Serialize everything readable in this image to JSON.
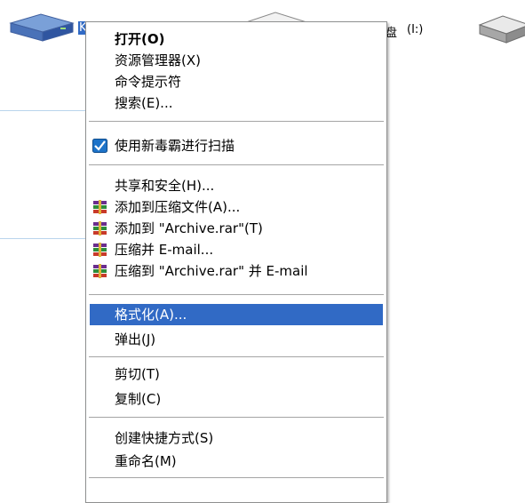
{
  "desktop": {
    "drive_left_label": "K",
    "drive_center_label": "(I:)",
    "drive_center_label_prefix": "盘"
  },
  "menu": {
    "items": [
      {
        "label": "打开(O)",
        "bold": true
      },
      {
        "label": "资源管理器(X)"
      },
      {
        "label": "命令提示符"
      },
      {
        "label": "搜索(E)..."
      },
      {
        "label": "使用新毒霸进行扫描",
        "icon": "duba-icon"
      },
      {
        "label": "共享和安全(H)..."
      },
      {
        "label": "添加到压缩文件(A)...",
        "icon": "winrar-icon"
      },
      {
        "label": "添加到 \"Archive.rar\"(T)",
        "icon": "winrar-icon"
      },
      {
        "label": "压缩并 E-mail...",
        "icon": "winrar-icon"
      },
      {
        "label": "压缩到 \"Archive.rar\" 并 E-mail",
        "icon": "winrar-icon"
      },
      {
        "label": "格式化(A)...",
        "highlighted": true
      },
      {
        "label": "弹出(J)"
      },
      {
        "label": "剪切(T)"
      },
      {
        "label": "复制(C)"
      },
      {
        "label": "创建快捷方式(S)"
      },
      {
        "label": "重命名(M)"
      }
    ]
  },
  "colors": {
    "highlight": "#316ac5",
    "separator": "#a5a5a5",
    "duba": "#1d73c9"
  }
}
